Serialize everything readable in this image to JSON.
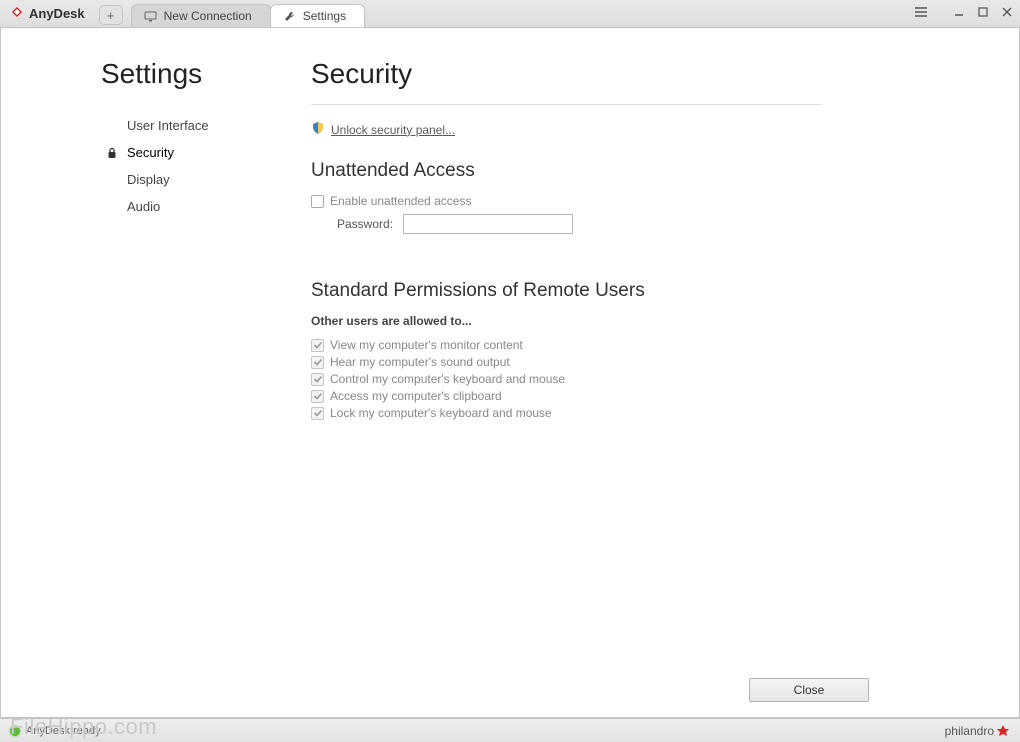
{
  "app": {
    "name": "AnyDesk"
  },
  "tabs": {
    "new_connection": "New Connection",
    "settings": "Settings"
  },
  "window_controls": {
    "menu": "≡",
    "min": "–",
    "max": "❐",
    "close": "✕"
  },
  "sidebar": {
    "title": "Settings",
    "items": [
      {
        "label": "User Interface"
      },
      {
        "label": "Security"
      },
      {
        "label": "Display"
      },
      {
        "label": "Audio"
      }
    ]
  },
  "main": {
    "title": "Security",
    "unlock_link": "Unlock security panel...",
    "unattended": {
      "title": "Unattended Access",
      "enable_label": "Enable unattended access",
      "password_label": "Password:",
      "password_value": ""
    },
    "permissions": {
      "title": "Standard Permissions of Remote Users",
      "subtitle": "Other users are allowed to...",
      "items": [
        {
          "label": "View my computer's monitor content"
        },
        {
          "label": "Hear my computer's sound output"
        },
        {
          "label": "Control my computer's keyboard and mouse"
        },
        {
          "label": "Access my computer's clipboard"
        },
        {
          "label": "Lock my computer's keyboard and mouse"
        }
      ]
    },
    "close_button": "Close"
  },
  "status": {
    "text": "AnyDesk ready.",
    "brand": "philandro"
  },
  "watermark": "FileHippo.com"
}
